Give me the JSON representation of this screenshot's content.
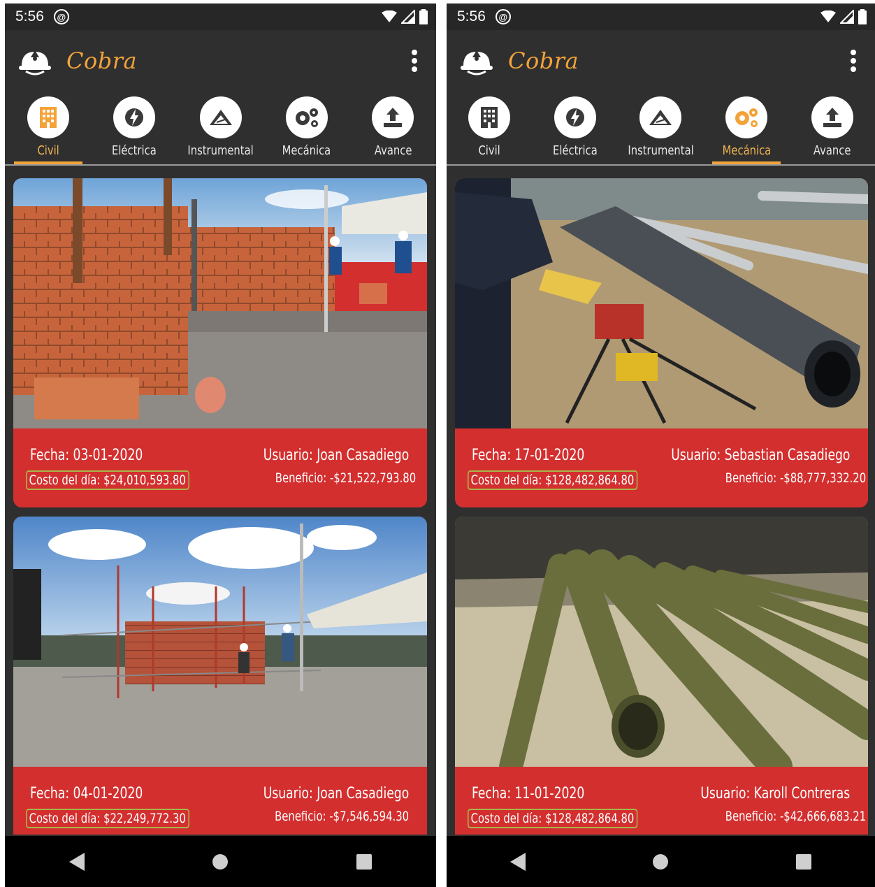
{
  "screens": [
    {
      "status_time": "5:56",
      "app_title": "Cobra",
      "tabs": [
        {
          "label": "Civil",
          "icon": "building-icon"
        },
        {
          "label": "Eléctrica",
          "icon": "bolt-icon"
        },
        {
          "label": "Instrumental",
          "icon": "instrument-icon"
        },
        {
          "label": "Mecánica",
          "icon": "gears-icon"
        },
        {
          "label": "Avance",
          "icon": "upload-icon"
        }
      ],
      "active_tab": "Civil",
      "cards": [
        {
          "fecha": "Fecha: 03-01-2020",
          "usuario": "Usuario: Joan Casadiego",
          "costo": "Costo del día: $24,010,593.80",
          "beneficio": "Beneficio: -$21,522,793.80"
        },
        {
          "fecha": "Fecha: 04-01-2020",
          "usuario": "Usuario: Joan Casadiego",
          "costo": "Costo del día: $22,249,772.30",
          "beneficio": "Beneficio: -$7,546,594.30"
        }
      ]
    },
    {
      "status_time": "5:56",
      "app_title": "Cobra",
      "tabs": [
        {
          "label": "Civil",
          "icon": "building-icon"
        },
        {
          "label": "Eléctrica",
          "icon": "bolt-icon"
        },
        {
          "label": "Instrumental",
          "icon": "instrument-icon"
        },
        {
          "label": "Mecánica",
          "icon": "gears-icon"
        },
        {
          "label": "Avance",
          "icon": "upload-icon"
        }
      ],
      "active_tab": "Mecánica",
      "cards": [
        {
          "fecha": "Fecha: 17-01-2020",
          "usuario": "Usuario: Sebastian Casadiego",
          "costo": "Costo del día: $128,482,864.80",
          "beneficio": "Beneficio: -$88,777,332.20"
        },
        {
          "fecha": "Fecha: 11-01-2020",
          "usuario": "Usuario: Karoll Contreras",
          "costo": "Costo del día: $128,482,864.80",
          "beneficio": "Beneficio: -$42,666,683.21"
        }
      ]
    }
  ],
  "colors": {
    "accent": "#f3a33a",
    "card_red": "#d32f2f",
    "background": "#2f2f2f",
    "highlight_box": "#a9b54a"
  }
}
